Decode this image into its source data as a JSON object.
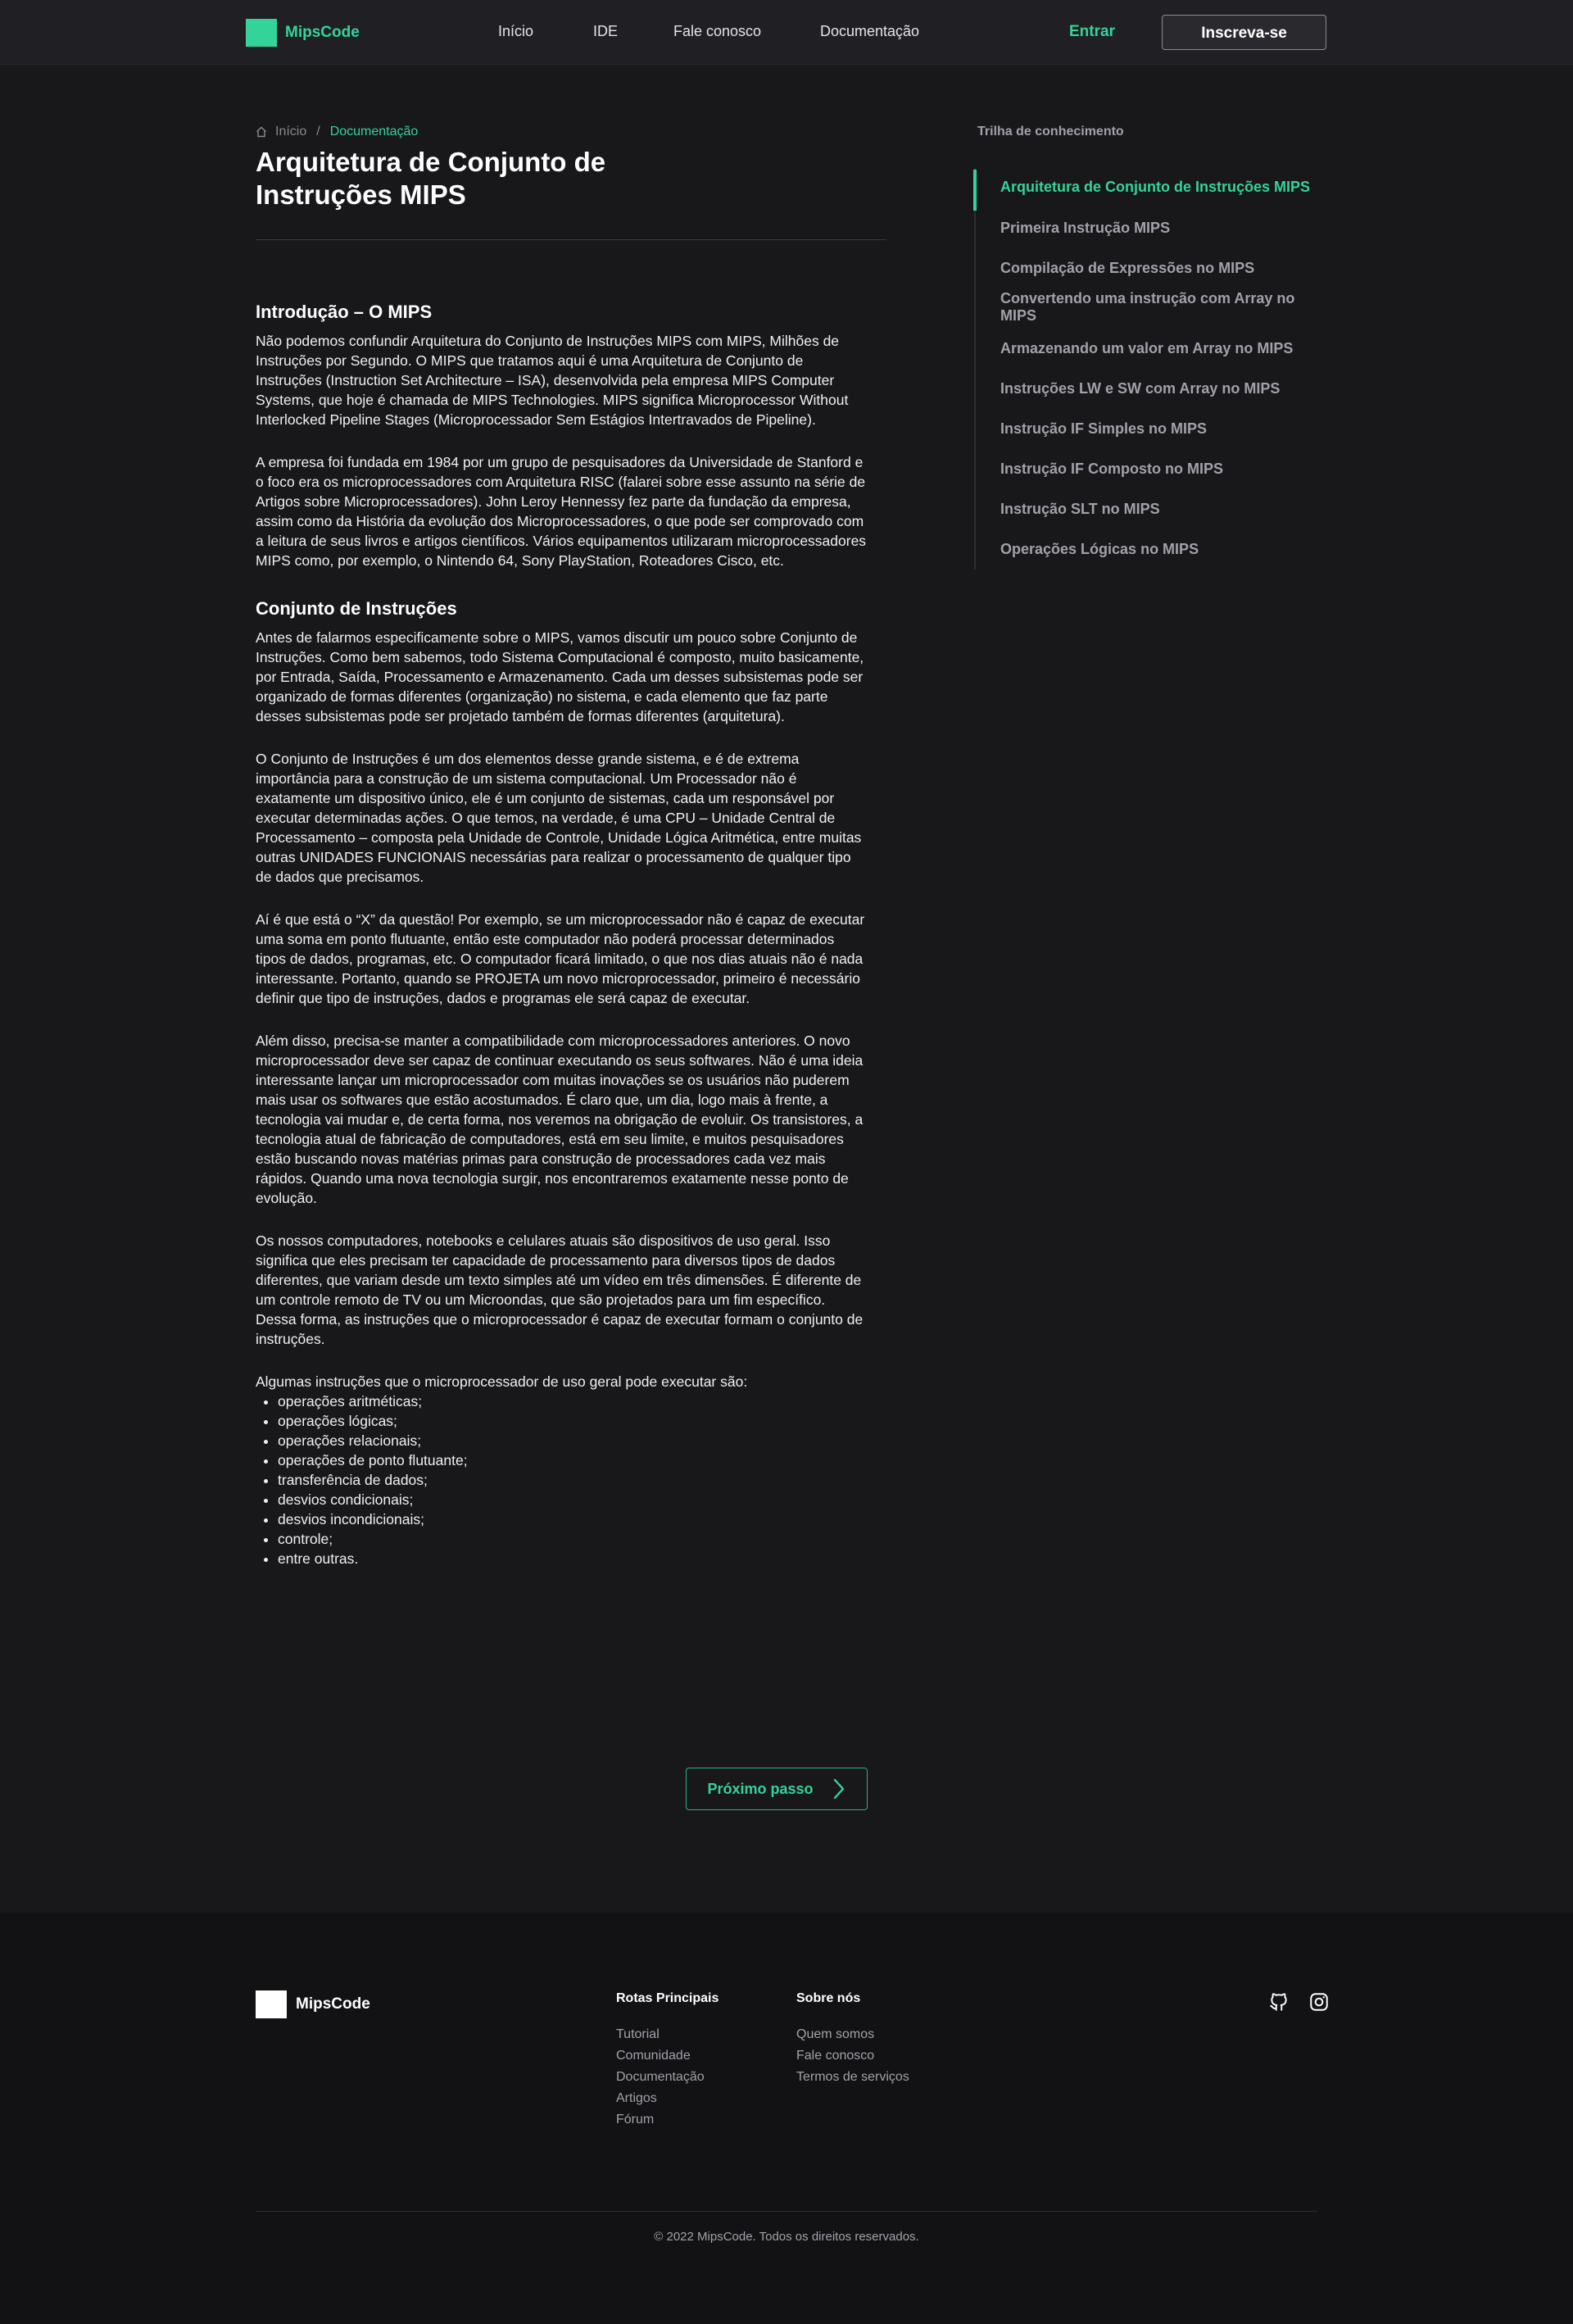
{
  "header": {
    "brand": "MipsCode",
    "nav": [
      "Início",
      "IDE",
      "Fale conosco",
      "Documentação"
    ],
    "login": "Entrar",
    "signup": "Inscreva-se"
  },
  "breadcrumb": {
    "home": "Início",
    "separator": "/",
    "current": "Documentação"
  },
  "page_title": "Arquitetura de Conjunto de Instruções MIPS",
  "sections": [
    {
      "heading": "Introdução – O MIPS",
      "paragraphs": [
        "Não podemos confundir Arquitetura do Conjunto de Instruções MIPS com MIPS, Milhões de Instruções por Segundo. O MIPS que tratamos aqui é uma Arquitetura de Conjunto de Instruções (Instruction Set Architecture – ISA), desenvolvida pela empresa MIPS Computer Systems, que hoje é chamada de MIPS Technologies. MIPS significa Microprocessor Without Interlocked Pipeline Stages (Microprocessador Sem Estágios Intertravados de Pipeline).",
        "A empresa foi fundada em 1984 por um grupo de pesquisadores da Universidade de Stanford e o foco era os microprocessadores com Arquitetura RISC (falarei sobre esse assunto na série de Artigos sobre Microprocessadores). John Leroy Hennessy fez parte da fundação da empresa, assim como da História da evolução dos Microprocessadores, o que pode ser comprovado com a leitura de seus livros e artigos científicos. Vários equipamentos utilizaram microprocessadores MIPS como, por exemplo, o Nintendo 64, Sony PlayStation, Roteadores Cisco, etc."
      ]
    },
    {
      "heading": "Conjunto de Instruções",
      "paragraphs": [
        "Antes de falarmos especificamente sobre o MIPS, vamos discutir um pouco sobre Conjunto de Instruções. Como bem sabemos, todo Sistema Computacional é composto, muito basicamente, por Entrada, Saída, Processamento e Armazenamento. Cada um desses subsistemas pode ser organizado de formas diferentes (organização) no sistema, e cada elemento que faz parte desses subsistemas pode ser projetado também de formas diferentes (arquitetura).",
        "O Conjunto de Instruções é um dos elementos desse grande sistema, e é de extrema importância para a construção de um sistema computacional. Um Processador não é exatamente um dispositivo único, ele é um conjunto de sistemas, cada um responsável por executar determinadas ações. O que temos, na verdade, é uma CPU – Unidade Central de Processamento – composta pela Unidade de Controle, Unidade Lógica Aritmética, entre muitas outras UNIDADES FUNCIONAIS necessárias para realizar o processamento de qualquer tipo de dados que precisamos.",
        "Aí é que está o “X” da questão! Por exemplo, se um microprocessador não é capaz de executar uma soma em ponto flutuante, então este computador não poderá processar determinados tipos de dados, programas, etc. O computador ficará limitado, o que nos dias atuais não é nada interessante. Portanto, quando se PROJETA um novo microprocessador, primeiro é necessário definir que tipo de instruções, dados e programas ele será capaz de executar.",
        "Além disso, precisa-se manter a compatibilidade com microprocessadores anteriores. O novo microprocessador deve ser capaz de continuar executando os seus softwares. Não é uma ideia interessante lançar um microprocessador com muitas inovações se os usuários não puderem mais usar os softwares que estão acostumados. É claro que, um dia, logo mais à frente, a tecnologia vai mudar e, de certa forma, nos veremos na obrigação de evoluir. Os transistores, a tecnologia atual de fabricação de computadores, está em seu limite, e muitos pesquisadores estão buscando novas matérias primas para construção de processadores cada vez mais rápidos. Quando uma nova tecnologia surgir, nos encontraremos exatamente nesse ponto de evolução.",
        "Os nossos computadores, notebooks e celulares atuais são dispositivos de uso geral. Isso significa que eles precisam ter capacidade de processamento para diversos tipos de dados diferentes, que variam desde um texto simples até um vídeo em três dimensões. É diferente de um controle remoto de TV ou um Microondas, que são projetados para um fim específico. Dessa forma, as instruções que o microprocessador é capaz de executar formam o conjunto de instruções.",
        "Algumas instruções que o microprocessador de uso geral pode executar são:"
      ],
      "list": [
        "operações aritméticas;",
        "operações lógicas;",
        "operações relacionais;",
        "operações de ponto flutuante;",
        "transferência de dados;",
        "desvios condicionais;",
        "desvios incondicionais;",
        "controle;",
        "entre outras."
      ]
    }
  ],
  "next_step": "Próximo passo",
  "sidebar": {
    "heading": "Trilha de conhecimento",
    "items": [
      "Arquitetura de Conjunto de Instruções MIPS",
      "Primeira Instrução MIPS",
      "Compilação de Expressões no MIPS",
      "Convertendo uma instrução com Array no MIPS",
      "Armazenando um valor em Array no MIPS",
      "Instruções LW e SW com Array no MIPS",
      "Instrução IF Simples no MIPS",
      "Instrução IF Composto no MIPS",
      "Instrução SLT no MIPS",
      "Operações Lógicas no MIPS"
    ],
    "active_index": 0
  },
  "footer": {
    "brand": "MipsCode",
    "columns": [
      {
        "title": "Rotas Principais",
        "links": [
          "Tutorial",
          "Comunidade",
          "Documentação",
          "Artigos",
          "Fórum"
        ]
      },
      {
        "title": "Sobre nós",
        "links": [
          "Quem somos",
          "Fale conosco",
          "Termos de serviços"
        ]
      }
    ],
    "social_icons": [
      "github-icon",
      "instagram-icon"
    ],
    "copyright": "© 2022 MipsCode. Todos os direitos reservados."
  },
  "colors": {
    "accent": "#34d399",
    "background": "#18181b",
    "header_bg": "#202024",
    "footer_bg": "#121214"
  }
}
